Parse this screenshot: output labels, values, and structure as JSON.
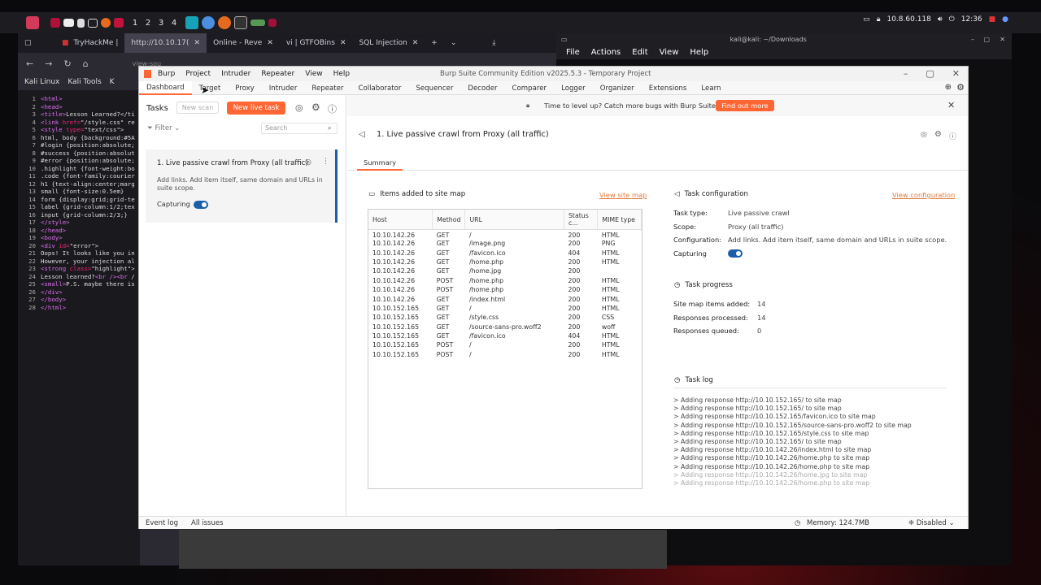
{
  "panel": {
    "workspaces": [
      "1",
      "2",
      "3",
      "4"
    ],
    "ip": "10.8.60.118",
    "time": "12:36"
  },
  "browser": {
    "tabs": [
      {
        "label": "TryHackMe |",
        "active": false
      },
      {
        "label": "http://10.10.17(",
        "active": true
      },
      {
        "label": "Online - Reve",
        "active": false
      },
      {
        "label": "vi | GTFOBins",
        "active": false
      },
      {
        "label": "SQL Injection",
        "active": false
      }
    ],
    "url_hint": "view-sou",
    "bookmarks": [
      "Kali Linux",
      "Kali Tools",
      "K"
    ],
    "source_lines": [
      {
        "n": "1",
        "html": "<span class='tag'>&lt;html&gt;</span>"
      },
      {
        "n": "2",
        "html": "<span class='tag'>&lt;head&gt;</span>"
      },
      {
        "n": "3",
        "html": "<span class='tag'>&lt;title&gt;</span>Lesson Learned?&lt;/ti"
      },
      {
        "n": "4",
        "html": "<span class='tag'>&lt;link</span> <span class='attr'>href=</span>\"/style.css\" re"
      },
      {
        "n": "5",
        "html": "<span class='tag'>&lt;style</span> <span class='attr'>type=</span>\"text/css\"&gt;"
      },
      {
        "n": "6",
        "html": "html, body {background:#5A"
      },
      {
        "n": "7",
        "html": "#login {position:absolute;"
      },
      {
        "n": "8",
        "html": "#success {position:absolut"
      },
      {
        "n": "9",
        "html": "#error {position:absolute;"
      },
      {
        "n": "10",
        "html": ".highlight {font-weight:bo"
      },
      {
        "n": "11",
        "html": ".code {font-family:courier"
      },
      {
        "n": "12",
        "html": "h1 {text-align:center;marg"
      },
      {
        "n": "13",
        "html": "small {font-size:0.5em}"
      },
      {
        "n": "14",
        "html": "form {display:grid;grid-te"
      },
      {
        "n": "15",
        "html": "label {grid-column:1/2;tex"
      },
      {
        "n": "16",
        "html": "input {grid-column:2/3;}"
      },
      {
        "n": "17",
        "html": "<span class='tag'>&lt;/style&gt;</span>"
      },
      {
        "n": "18",
        "html": "<span class='tag'>&lt;/head&gt;</span>"
      },
      {
        "n": "19",
        "html": "<span class='tag'>&lt;body&gt;</span>"
      },
      {
        "n": "20",
        "html": "<span class='tag'>&lt;div</span> <span class='attr'>id=</span>\"error\"&gt;"
      },
      {
        "n": "21",
        "html": "Oops! It looks like you in"
      },
      {
        "n": "22",
        "html": "However, your injection al"
      },
      {
        "n": "23",
        "html": "<span class='tag'>&lt;strong</span> <span class='attr'>class=</span>\"highlight\"&gt;"
      },
      {
        "n": "24",
        "html": "Lesson learned?<span class='tag'>&lt;br /&gt;&lt;br</span> /"
      },
      {
        "n": "25",
        "html": "<span class='tag'>&lt;small&gt;</span>P.S. maybe there is"
      },
      {
        "n": "26",
        "html": "<span class='tag'>&lt;/div&gt;</span>"
      },
      {
        "n": "27",
        "html": "<span class='tag'>&lt;/body&gt;</span>"
      },
      {
        "n": "28",
        "html": "<span class='tag'>&lt;/html&gt;</span>"
      }
    ]
  },
  "terminal": {
    "title": "kali@kali: ~/Downloads",
    "menu": [
      "File",
      "Actions",
      "Edit",
      "View",
      "Help"
    ]
  },
  "burp": {
    "menu": [
      "Burp",
      "Project",
      "Intruder",
      "Repeater",
      "View",
      "Help"
    ],
    "window_title": "Burp Suite Community Edition v2025.5.3 - Temporary Project",
    "tabs": [
      "Dashboard",
      "Target",
      "Proxy",
      "Intruder",
      "Repeater",
      "Collaborator",
      "Sequencer",
      "Decoder",
      "Comparer",
      "Logger",
      "Organizer",
      "Extensions",
      "Learn"
    ],
    "tasks": {
      "title": "Tasks",
      "new_scan": "New scan",
      "new_live_task": "New live task",
      "filter": "Filter",
      "search_placeholder": "Search",
      "card": {
        "title": "1. Live passive crawl from Proxy (all traffic)",
        "desc": "Add links. Add item itself, same domain and URLs in suite scope.",
        "status": "Capturing"
      }
    },
    "banner": {
      "text": "Time to level up? Catch more bugs with Burp Suite Pro",
      "button": "Find out more"
    },
    "detail": {
      "title": "1. Live passive crawl from Proxy (all traffic)",
      "tab": "Summary",
      "sitemap": {
        "title": "Items added to site map",
        "link": "View site map",
        "columns": [
          "Host",
          "Method",
          "URL",
          "Status c...",
          "MIME type"
        ],
        "rows": [
          [
            "10.10.142.26",
            "GET",
            "/",
            "200",
            "HTML"
          ],
          [
            "10.10.142.26",
            "GET",
            "/image.png",
            "200",
            "PNG"
          ],
          [
            "10.10.142.26",
            "GET",
            "/favicon.ico",
            "404",
            "HTML"
          ],
          [
            "10.10.142.26",
            "GET",
            "/home.php",
            "200",
            "HTML"
          ],
          [
            "10.10.142.26",
            "GET",
            "/home.jpg",
            "200",
            ""
          ],
          [
            "10.10.142.26",
            "POST",
            "/home.php",
            "200",
            "HTML"
          ],
          [
            "10.10.142.26",
            "POST",
            "/home.php",
            "200",
            "HTML"
          ],
          [
            "10.10.142.26",
            "GET",
            "/index.html",
            "200",
            "HTML"
          ],
          [
            "10.10.152.165",
            "GET",
            "/",
            "200",
            "HTML"
          ],
          [
            "10.10.152.165",
            "GET",
            "/style.css",
            "200",
            "CSS"
          ],
          [
            "10.10.152.165",
            "GET",
            "/source-sans-pro.woff2",
            "200",
            "woff"
          ],
          [
            "10.10.152.165",
            "GET",
            "/favicon.ico",
            "404",
            "HTML"
          ],
          [
            "10.10.152.165",
            "POST",
            "/",
            "200",
            "HTML"
          ],
          [
            "10.10.152.165",
            "POST",
            "/",
            "200",
            "HTML"
          ]
        ]
      },
      "config": {
        "title": "Task configuration",
        "link": "View configuration",
        "task_type_k": "Task type:",
        "task_type_v": "Live passive crawl",
        "scope_k": "Scope:",
        "scope_v": "Proxy (all traffic)",
        "configuration_k": "Configuration:",
        "configuration_v": "Add links. Add item itself, same domain and URLs in suite scope.",
        "capturing_k": "Capturing"
      },
      "progress": {
        "title": "Task progress",
        "items_k": "Site map items added:",
        "items_v": "14",
        "processed_k": "Responses processed:",
        "processed_v": "14",
        "queued_k": "Responses queued:",
        "queued_v": "0"
      },
      "log": {
        "title": "Task log",
        "lines": [
          "> Adding response http://10.10.152.165/ to site map",
          "> Adding response http://10.10.152.165/ to site map",
          "> Adding response http://10.10.152.165/favicon.ico to site map",
          "> Adding response http://10.10.152.165/source-sans-pro.woff2 to site map",
          "> Adding response http://10.10.152.165/style.css to site map",
          "> Adding response http://10.10.152.165/ to site map",
          "> Adding response http://10.10.142.26/index.html to site map",
          "> Adding response http://10.10.142.26/home.php to site map",
          "> Adding response http://10.10.142.26/home.php to site map",
          "> Adding response http://10.10.142.26/home.jpg to site map",
          "> Adding response http://10.10.142.26/home.php to site map"
        ]
      }
    },
    "status": {
      "event_log": "Event log",
      "all_issues": "All issues",
      "memory": "Memory: 124.7MB",
      "disabled": "Disabled"
    }
  },
  "colors": {
    "accent": "#ff6633",
    "toggle": "#1a5fa8",
    "link": "#e07a3c"
  }
}
